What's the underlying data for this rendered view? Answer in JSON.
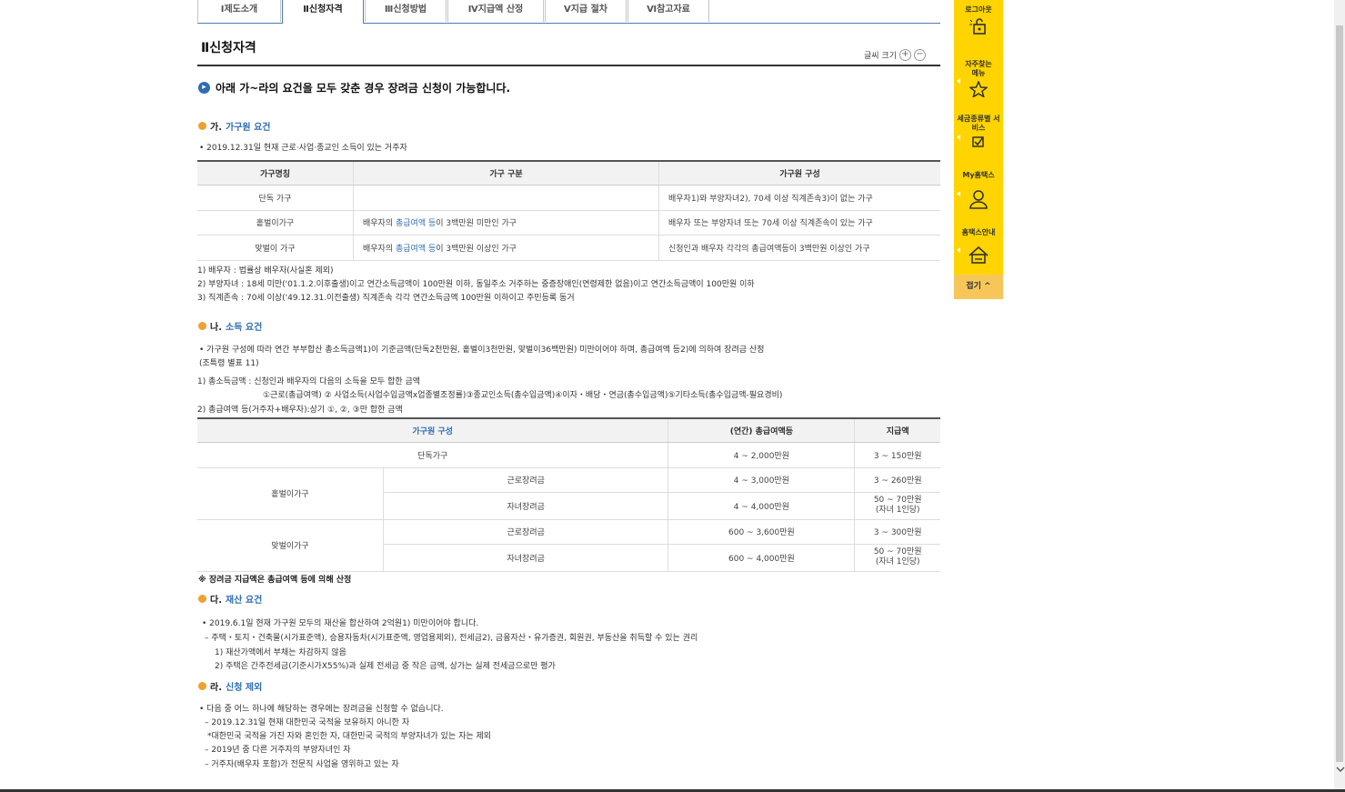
{
  "tabs": [
    "Ⅰ제도소개",
    "Ⅱ신청자격",
    "Ⅲ신청방법",
    "Ⅳ지급액 산정",
    "Ⅴ지급 절차",
    "Ⅵ참고자료"
  ],
  "page_title": "Ⅱ신청자격",
  "font_size_label": "글씨 크기",
  "font_plus": "+",
  "font_minus": "−",
  "intro": "아래 가~라의 요건을 모두 갖춘 경우 장려금 신청이 가능합니다.",
  "sec_a": {
    "prefix": "가.",
    "title": "가구원 요건"
  },
  "sec_a_line": "• 2019.12.31일 현재 근로·사업·종교인 소득이 있는 거주자",
  "table1": {
    "headers": [
      "가구명칭",
      "가구 구분",
      "가구원 구성"
    ],
    "rows": [
      {
        "name": "단독 가구",
        "div_pre": "",
        "div_link": "",
        "div_post": "",
        "comp": "배우자1)와 부양자녀2), 70세 이상 직계존속3)이 없는 가구"
      },
      {
        "name": "홑벌이가구",
        "div_pre": "배우자의 ",
        "div_link": "총급여액 등",
        "div_post": "이 3백만원 미만인 가구",
        "comp": "배우자 또는 부양자녀 또는 70세 이상 직계존속이 있는 가구"
      },
      {
        "name": "맞벌이 가구",
        "div_pre": "배우자의 ",
        "div_link": "총급여액 등",
        "div_post": "이 3백만원 이상인 가구",
        "comp": "신청인과 배우자 각각의 총급여액등이 3백만원 이상인 가구"
      }
    ]
  },
  "notes1": [
    "1) 배우자 : 법률상 배우자(사실혼 제외)",
    "2) 부양자녀 : 18세 미만('01.1.2.이후출생)이고 연간소득금액이 100만원 이하, 동일주소 거주하는 중증장애인(연령제한 없음)이고 연간소득금액이 100만원 이하",
    "3) 직계존속 : 70세 이상('49.12.31.이전출생) 직계존속 각각 연간소득금액 100만원 이하이고 주민등록 동거"
  ],
  "sec_b": {
    "prefix": "나.",
    "title": "소득 요건"
  },
  "sec_b_lines": [
    "• 가구원 구성에 따라 연간 부부합산 총소득금액1)이 기준금액(단독2천만원, 홑벌이3천만원, 맞벌이36백만원) 미만이어야 하며, 총급여액 등2)에 의하여 장려금 산정",
    "  (조특령 별표 11)"
  ],
  "sec_b_notes": [
    "1) 총소득금액 : 신청인과 배우자의 다음의 소득을 모두 합한 금액",
    "①근로(총급여액) ② 사업소득(사업수입금액x업종별조정률)③종교인소득(총수입금액)④이자・배당・연금(총수입금액)⑤기타소득(총수입금액-필요경비)",
    "2) 총급여액 등(거주자+배우자):상기 ①, ②, ③만 합한 금액"
  ],
  "table2": {
    "headers": [
      "가구원 구성",
      "(연간) 총급여액등",
      "지급액"
    ],
    "single": {
      "name": "단독가구",
      "income": "4 ~ 2,000만원",
      "pay": "3 ~ 150만원"
    },
    "single_earner": {
      "name": "홑벌이가구",
      "rows": [
        {
          "kind": "근로장려금",
          "income": "4 ~ 3,000만원",
          "pay": "3 ~ 260만원",
          "pay2": ""
        },
        {
          "kind": "자녀장려금",
          "income": "4 ~ 4,000만원",
          "pay": "50 ~ 70만원",
          "pay2": "(자녀 1인당)"
        }
      ]
    },
    "dual_earner": {
      "name": "맞벌이가구",
      "rows": [
        {
          "kind": "근로장려금",
          "income": "600 ~ 3,600만원",
          "pay": "3 ~ 300만원",
          "pay2": ""
        },
        {
          "kind": "자녀장려금",
          "income": "600 ~ 4,000만원",
          "pay": "50 ~ 70만원",
          "pay2": "(자녀 1인당)"
        }
      ]
    }
  },
  "note_after_t2": "※ 장려금 지급액은 총급여액 등에 의해 산정",
  "sec_c": {
    "prefix": "다.",
    "title": "재산 요건"
  },
  "sec_c_lines": [
    "• 2019.6.1일 현재 가구원 모두의 재산을 합산하여 2억원1) 미만이어야 합니다.",
    " – 주택・토지・건축물(시가표준액), 승용자동차(시가표준액, 영업용제외), 전세금2), 금융자산・유가증권, 회원권, 부동산을 취득할 수 있는 권리",
    "   1) 재산가액에서 부채는 차감하지 않음",
    "   2) 주택은 간주전세금(기준시가X55%)과 실제 전세금 중 작은 금액, 상가는 실제 전세금으로만 평가"
  ],
  "sec_d": {
    "prefix": "라.",
    "title": "신청 제외"
  },
  "sec_d_lines": [
    "• 다음 중 어느 하나에 해당하는 경우에는 장려금을 신청할 수 없습니다.",
    " – 2019.12.31일 현재 대한민국 국적을 보유하지 아니한 자",
    "  *대한민국 국적을 가진 자와 혼인한 자, 대한민국 국적의 부양자녀가 있는 자는 제외",
    " – 2019년 중 다른 거주자의 부양자녀인 자",
    " – 거주자(배우자 포함)가 전문직 사업을 영위하고 있는 자"
  ],
  "sidebar": {
    "logout": "로그아웃",
    "faq_menu": "자주찾는 메뉴",
    "tax_service": "세금종류별 서비스",
    "my_hometax": "My홈택스",
    "hometax_guide": "홈택스안내",
    "fold": "접기 ^"
  },
  "colors": {
    "accent_blue": "#2e6db4",
    "sidebar_yellow": "#ffd400",
    "bullet_orange": "#f0a030"
  }
}
